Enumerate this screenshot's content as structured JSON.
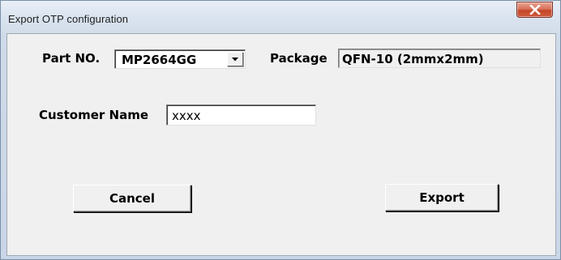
{
  "window": {
    "title": "Export OTP configuration",
    "close_icon": "close-icon",
    "accent_close": "#c44628"
  },
  "form": {
    "part_label": "Part NO.",
    "part_value": "MP2664GG",
    "part_dropdown_icon": "chevron-down-icon",
    "package_label": "Package",
    "package_value": "QFN-10 (2mmx2mm)",
    "customer_label": "Customer Name",
    "customer_value": "xxxx"
  },
  "buttons": {
    "cancel_label": "Cancel",
    "export_label": "Export"
  }
}
